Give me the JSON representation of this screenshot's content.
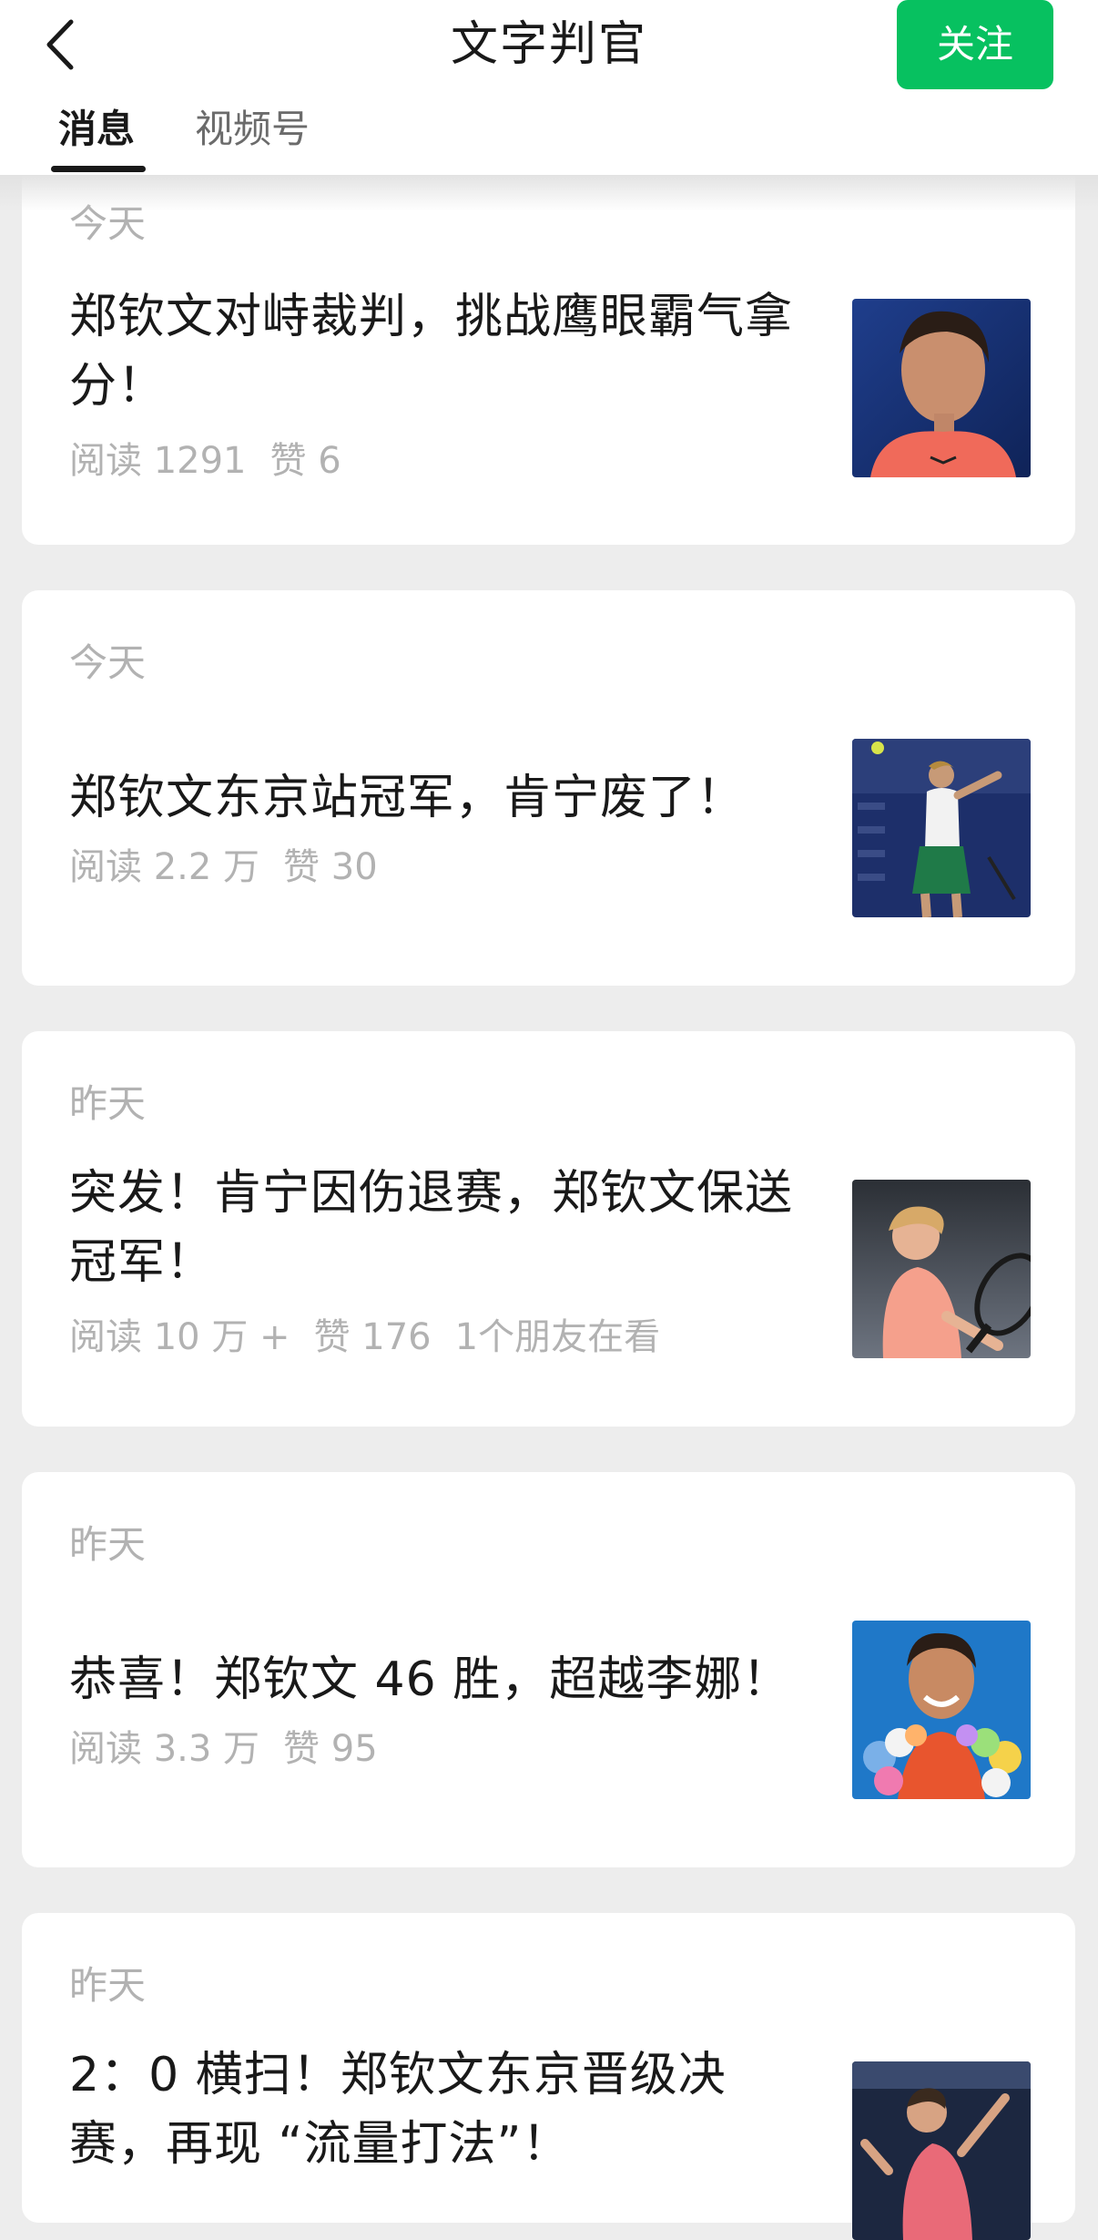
{
  "header": {
    "title": "文字判官",
    "follow_label": "关注",
    "tabs": [
      {
        "label": "消息",
        "active": true
      },
      {
        "label": "视频号",
        "active": false
      }
    ]
  },
  "articles": [
    {
      "date": "今天",
      "title": "郑钦文对峙裁判，挑战鹰眼霸气拿分！",
      "read": "阅读 1291",
      "likes": "赞 6",
      "friends": "",
      "thumb": "zheng-portrait-coral"
    },
    {
      "date": "今天",
      "title": "郑钦文东京站冠军，肯宁废了！",
      "read": "阅读 2.2 万",
      "likes": "赞 30",
      "friends": "",
      "thumb": "kenin-forehand"
    },
    {
      "date": "昨天",
      "title": "突发！肯宁因伤退赛，郑钦文保送冠军！",
      "read": "阅读 10 万 +",
      "likes": "赞 176",
      "friends": "1个朋友在看",
      "thumb": "kenin-racket"
    },
    {
      "date": "昨天",
      "title": "恭喜！郑钦文 46 胜，超越李娜！",
      "read": "阅读 3.3 万",
      "likes": "赞 95",
      "friends": "",
      "thumb": "zheng-garland"
    },
    {
      "date": "昨天",
      "title": "2：0 横扫！郑钦文东京晋级决赛，再现 “流量打法”！",
      "read": "",
      "likes": "",
      "friends": "",
      "thumb": "zheng-serve"
    }
  ],
  "colors": {
    "accent": "#07c160",
    "background": "#ededed",
    "muted_text": "#b2b2b2"
  }
}
